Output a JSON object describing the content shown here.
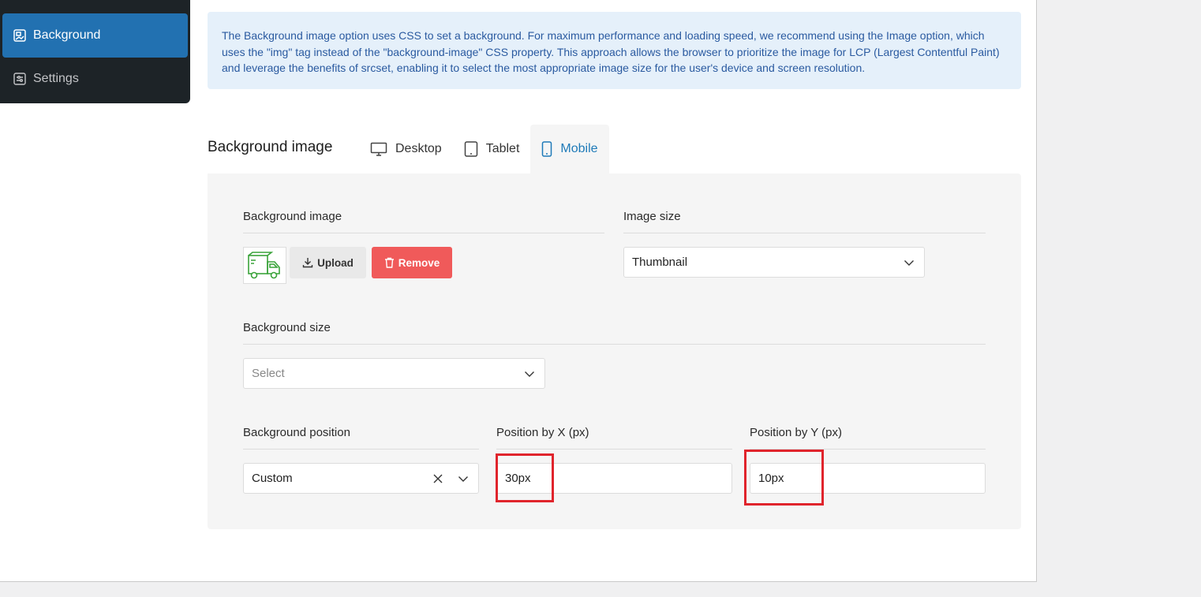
{
  "sidebar": {
    "items": [
      {
        "label": "Background",
        "icon": "background-icon",
        "active": true
      },
      {
        "label": "Settings",
        "icon": "settings-sliders-icon",
        "active": false
      }
    ]
  },
  "notice": {
    "text": "The Background image option uses CSS to set a background. For maximum performance and loading speed, we recommend using the Image option, which uses the \"img\" tag instead of the \"background-image\" CSS property. This approach allows the browser to prioritize the image for LCP (Largest Contentful Paint) and leverage the benefits of srcset, enabling it to select the most appropriate image size for the user's device and screen resolution."
  },
  "section": {
    "title": "Background image",
    "tabs": [
      {
        "label": "Desktop",
        "icon": "desktop-icon"
      },
      {
        "label": "Tablet",
        "icon": "tablet-icon"
      },
      {
        "label": "Mobile",
        "icon": "mobile-icon",
        "active": true
      }
    ]
  },
  "fields": {
    "bg_image": {
      "label": "Background image",
      "upload_label": "Upload",
      "remove_label": "Remove",
      "thumbnail_icon": "delivery-truck-icon"
    },
    "image_size": {
      "label": "Image size",
      "value": "Thumbnail"
    },
    "bg_size": {
      "label": "Background size",
      "placeholder": "Select"
    },
    "bg_position": {
      "label": "Background position",
      "value": "Custom"
    },
    "pos_x": {
      "label": "Position by X (px)",
      "value": "30px"
    },
    "pos_y": {
      "label": "Position by Y (px)",
      "value": "10px"
    }
  },
  "colors": {
    "accent": "#2271b1",
    "remove": "#f05a5a",
    "highlight": "#e0242c",
    "notice_bg": "#e5f0fa",
    "active_tab_text": "#1e7ab8"
  }
}
